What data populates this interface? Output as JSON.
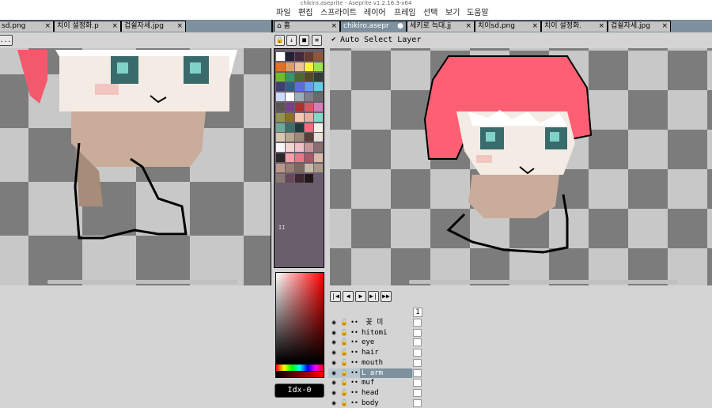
{
  "window": {
    "title": "chikiro.aseprite - Aseprite v1.2.16.3-x64"
  },
  "menu": [
    "파일",
    "편집",
    "스프라이트",
    "레이어",
    "프레임",
    "선택",
    "보기",
    "도움말"
  ],
  "left_tabs": [
    {
      "label": "sd.png",
      "close": "×"
    },
    {
      "label": "치이 설정화.p",
      "close": "×"
    },
    {
      "label": "겁쉴자세.jpg",
      "close": "×"
    }
  ],
  "right_tabs": [
    {
      "label": "홈",
      "close": "×"
    },
    {
      "label": "chikiro.asepr",
      "close": "●",
      "active": true
    },
    {
      "label": "세키로 늑대.jj",
      "close": "×"
    },
    {
      "label": "치이sd.png",
      "close": "×"
    },
    {
      "label": "치이 설정화.",
      "close": "×"
    },
    {
      "label": "겁쉴자세.jpg",
      "close": "×"
    }
  ],
  "toolbar": {
    "left_button": "...",
    "auto_select_check": "✔",
    "auto_select_label": "Auto Select Layer"
  },
  "palette": {
    "colors": [
      "#ffffff",
      "#222034",
      "#45283c",
      "#663931",
      "#8f563b",
      "#df7126",
      "#d9a066",
      "#eec39a",
      "#fbf236",
      "#99e550",
      "#6abe30",
      "#37946e",
      "#4b692f",
      "#524b24",
      "#323c39",
      "#3f3f74",
      "#306082",
      "#5b6ee1",
      "#639bff",
      "#5fcde4",
      "#cbdbfc",
      "#ffffff",
      "#9badb7",
      "#847e87",
      "#696a6a",
      "#595652",
      "#76428a",
      "#ac3232",
      "#d95763",
      "#d77bba",
      "#8f974a",
      "#8a6f30",
      "#f8c9b0",
      "#e8b0a0",
      "#7fd8c8",
      "#6fa89a",
      "#3a7068",
      "#1e3a3a",
      "#ff6680",
      "#f4f0e6",
      "#d8c8b0",
      "#b8a890",
      "#a08878",
      "#584038",
      "#e8e0d8",
      "#f8f8f8",
      "#f0d8d0",
      "#f0c0c8",
      "#c89898",
      "#887070",
      "#282828",
      "#f4a0a8",
      "#e87888",
      "#a85868",
      "#d8b8a8",
      "#b89888",
      "#988070",
      "#786860",
      "#c8b8a8",
      "#a89888",
      "#887870",
      "#684858",
      "#3c2830",
      "#201818"
    ],
    "marker": "II"
  },
  "color_picker": {
    "idx_label": "Idx-0"
  },
  "timeline": {
    "frame_buttons": [
      "|◀",
      "◀",
      "▶",
      "▶|",
      "▶▶"
    ],
    "frame_number": "1",
    "layers": [
      {
        "name": " 꽃 미",
        "selected": false
      },
      {
        "name": "hitomi",
        "selected": false
      },
      {
        "name": "eye",
        "selected": false
      },
      {
        "name": "hair",
        "selected": false
      },
      {
        "name": "mouth",
        "selected": false
      },
      {
        "name": "L arm",
        "selected": true
      },
      {
        "name": "muf",
        "selected": false
      },
      {
        "name": "head",
        "selected": false
      },
      {
        "name": "body",
        "selected": false
      }
    ]
  }
}
